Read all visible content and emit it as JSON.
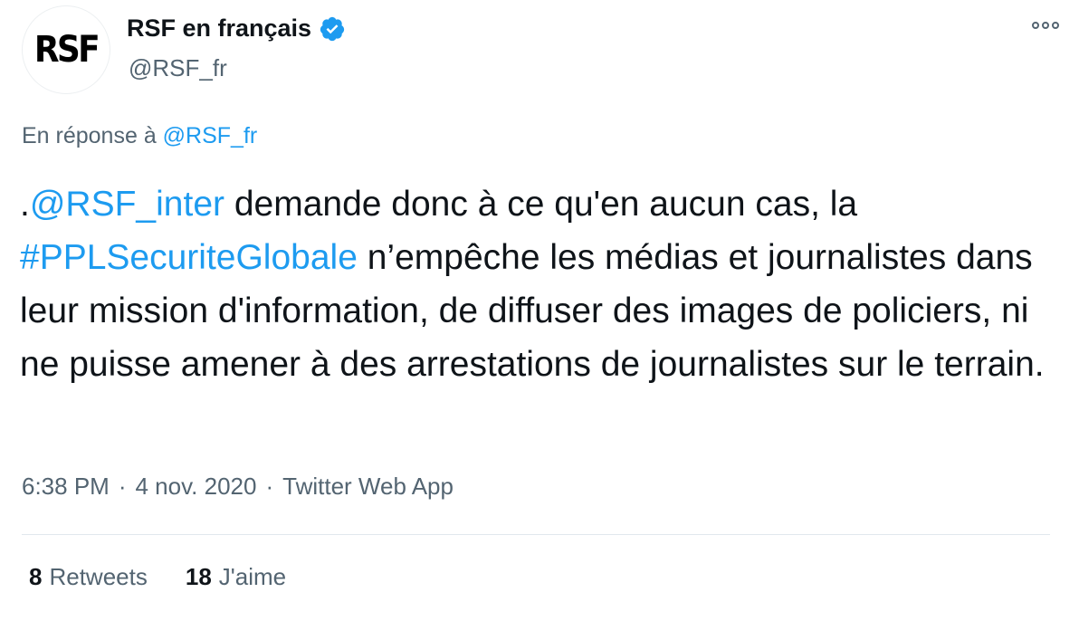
{
  "author": {
    "avatar_text": "RSF",
    "display_name": "RSF en français",
    "handle": "@RSF_fr",
    "verified_icon": "verified-badge-icon",
    "more_icon": "more-options-icon"
  },
  "reply": {
    "prefix": "En réponse à",
    "handle": "@RSF_fr"
  },
  "body": {
    "segments": [
      {
        "text": ".",
        "type": "text"
      },
      {
        "text": "@RSF_inter",
        "type": "mention"
      },
      {
        "text": " demande donc à ce qu'en aucun cas, la ",
        "type": "text"
      },
      {
        "text": "#PPLSecuriteGlobale",
        "type": "hashtag"
      },
      {
        "text": " n’empêche les médias et journalistes dans leur mission d'information, de diffuser des images de policiers, ni ne puisse amener à des arrestations de journalistes sur le terrain.",
        "type": "text"
      }
    ]
  },
  "meta": {
    "time": "6:38 PM",
    "separator": "·",
    "date": "4 nov. 2020",
    "source": "Twitter Web App"
  },
  "stats": {
    "retweets_count": "8",
    "retweets_label": "Retweets",
    "likes_count": "18",
    "likes_label": "J'aime"
  },
  "colors": {
    "link": "#1d9bf0",
    "secondary_text": "#536471",
    "primary_text": "#0f1419"
  }
}
